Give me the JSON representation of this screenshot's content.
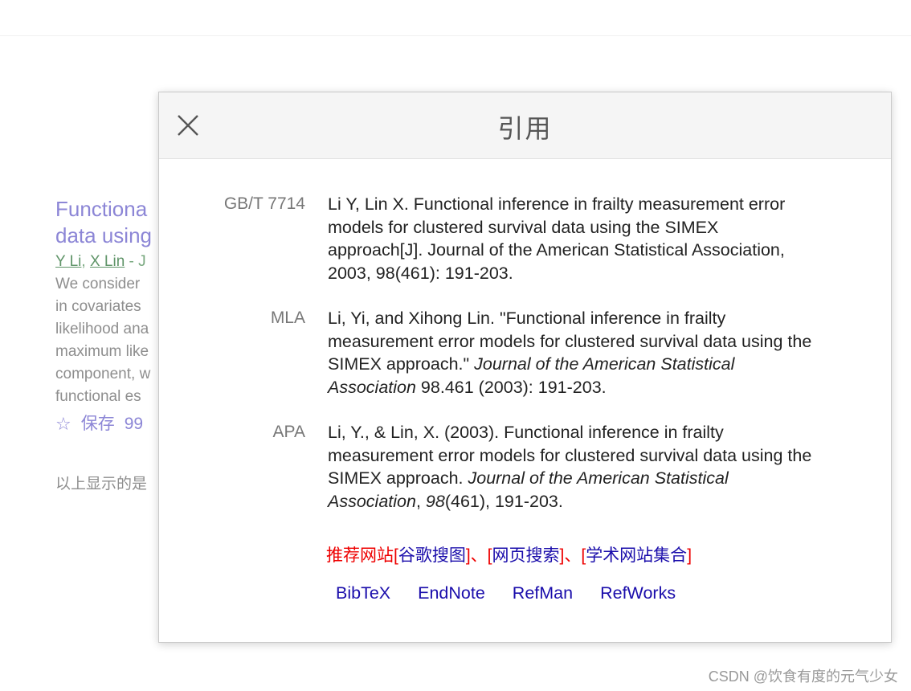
{
  "background": {
    "result_title_line1": "Functiona",
    "result_title_line2": "data using",
    "author1": "Y Li",
    "author2": "X Lin",
    "author_tail": " - J",
    "snippet_lines": [
      "We consider",
      "in covariates",
      "likelihood ana",
      "maximum like",
      "component, w",
      "functional es"
    ],
    "save_label": "保存",
    "cite_fragment": "99",
    "note": "以上显示的是"
  },
  "modal": {
    "title": "引用",
    "citations": [
      {
        "label": "GB/T 7714",
        "text": "Li Y, Lin X. Functional inference in frailty measurement error models for clustered survival data using the SIMEX approach[J]. Journal of the American Statistical Association, 2003, 98(461): 191-203."
      },
      {
        "label": "MLA",
        "pre": "Li, Yi, and Xihong Lin. \"Functional inference in frailty measurement error models for clustered survival data using the SIMEX approach.\" ",
        "italic": "Journal of the American Statistical Association",
        "post": " 98.461 (2003): 191-203."
      },
      {
        "label": "APA",
        "pre": "Li, Y., & Lin, X. (2003). Functional inference in frailty measurement error models for clustered survival data using the SIMEX approach. ",
        "italic": "Journal of the American Statistical Association",
        "mid": ", ",
        "italic2": "98",
        "post": "(461), 191-203."
      }
    ],
    "recommend_label": "推荐网站",
    "link1": "谷歌搜图",
    "link2": "网页搜索",
    "link3": "学术网站集合",
    "export_links": [
      "BibTeX",
      "EndNote",
      "RefMan",
      "RefWorks"
    ]
  },
  "watermark": "CSDN @饮食有度的元气少女"
}
